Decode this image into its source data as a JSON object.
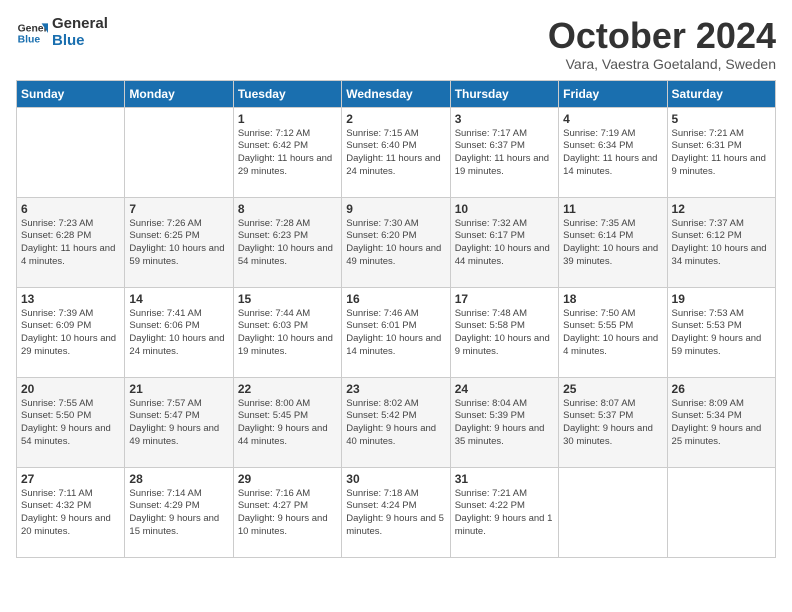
{
  "logo": {
    "line1": "General",
    "line2": "Blue"
  },
  "title": "October 2024",
  "subtitle": "Vara, Vaestra Goetaland, Sweden",
  "weekdays": [
    "Sunday",
    "Monday",
    "Tuesday",
    "Wednesday",
    "Thursday",
    "Friday",
    "Saturday"
  ],
  "weeks": [
    [
      {
        "day": "",
        "text": ""
      },
      {
        "day": "",
        "text": ""
      },
      {
        "day": "1",
        "text": "Sunrise: 7:12 AM\nSunset: 6:42 PM\nDaylight: 11 hours and 29 minutes."
      },
      {
        "day": "2",
        "text": "Sunrise: 7:15 AM\nSunset: 6:40 PM\nDaylight: 11 hours and 24 minutes."
      },
      {
        "day": "3",
        "text": "Sunrise: 7:17 AM\nSunset: 6:37 PM\nDaylight: 11 hours and 19 minutes."
      },
      {
        "day": "4",
        "text": "Sunrise: 7:19 AM\nSunset: 6:34 PM\nDaylight: 11 hours and 14 minutes."
      },
      {
        "day": "5",
        "text": "Sunrise: 7:21 AM\nSunset: 6:31 PM\nDaylight: 11 hours and 9 minutes."
      }
    ],
    [
      {
        "day": "6",
        "text": "Sunrise: 7:23 AM\nSunset: 6:28 PM\nDaylight: 11 hours and 4 minutes."
      },
      {
        "day": "7",
        "text": "Sunrise: 7:26 AM\nSunset: 6:25 PM\nDaylight: 10 hours and 59 minutes."
      },
      {
        "day": "8",
        "text": "Sunrise: 7:28 AM\nSunset: 6:23 PM\nDaylight: 10 hours and 54 minutes."
      },
      {
        "day": "9",
        "text": "Sunrise: 7:30 AM\nSunset: 6:20 PM\nDaylight: 10 hours and 49 minutes."
      },
      {
        "day": "10",
        "text": "Sunrise: 7:32 AM\nSunset: 6:17 PM\nDaylight: 10 hours and 44 minutes."
      },
      {
        "day": "11",
        "text": "Sunrise: 7:35 AM\nSunset: 6:14 PM\nDaylight: 10 hours and 39 minutes."
      },
      {
        "day": "12",
        "text": "Sunrise: 7:37 AM\nSunset: 6:12 PM\nDaylight: 10 hours and 34 minutes."
      }
    ],
    [
      {
        "day": "13",
        "text": "Sunrise: 7:39 AM\nSunset: 6:09 PM\nDaylight: 10 hours and 29 minutes."
      },
      {
        "day": "14",
        "text": "Sunrise: 7:41 AM\nSunset: 6:06 PM\nDaylight: 10 hours and 24 minutes."
      },
      {
        "day": "15",
        "text": "Sunrise: 7:44 AM\nSunset: 6:03 PM\nDaylight: 10 hours and 19 minutes."
      },
      {
        "day": "16",
        "text": "Sunrise: 7:46 AM\nSunset: 6:01 PM\nDaylight: 10 hours and 14 minutes."
      },
      {
        "day": "17",
        "text": "Sunrise: 7:48 AM\nSunset: 5:58 PM\nDaylight: 10 hours and 9 minutes."
      },
      {
        "day": "18",
        "text": "Sunrise: 7:50 AM\nSunset: 5:55 PM\nDaylight: 10 hours and 4 minutes."
      },
      {
        "day": "19",
        "text": "Sunrise: 7:53 AM\nSunset: 5:53 PM\nDaylight: 9 hours and 59 minutes."
      }
    ],
    [
      {
        "day": "20",
        "text": "Sunrise: 7:55 AM\nSunset: 5:50 PM\nDaylight: 9 hours and 54 minutes."
      },
      {
        "day": "21",
        "text": "Sunrise: 7:57 AM\nSunset: 5:47 PM\nDaylight: 9 hours and 49 minutes."
      },
      {
        "day": "22",
        "text": "Sunrise: 8:00 AM\nSunset: 5:45 PM\nDaylight: 9 hours and 44 minutes."
      },
      {
        "day": "23",
        "text": "Sunrise: 8:02 AM\nSunset: 5:42 PM\nDaylight: 9 hours and 40 minutes."
      },
      {
        "day": "24",
        "text": "Sunrise: 8:04 AM\nSunset: 5:39 PM\nDaylight: 9 hours and 35 minutes."
      },
      {
        "day": "25",
        "text": "Sunrise: 8:07 AM\nSunset: 5:37 PM\nDaylight: 9 hours and 30 minutes."
      },
      {
        "day": "26",
        "text": "Sunrise: 8:09 AM\nSunset: 5:34 PM\nDaylight: 9 hours and 25 minutes."
      }
    ],
    [
      {
        "day": "27",
        "text": "Sunrise: 7:11 AM\nSunset: 4:32 PM\nDaylight: 9 hours and 20 minutes."
      },
      {
        "day": "28",
        "text": "Sunrise: 7:14 AM\nSunset: 4:29 PM\nDaylight: 9 hours and 15 minutes."
      },
      {
        "day": "29",
        "text": "Sunrise: 7:16 AM\nSunset: 4:27 PM\nDaylight: 9 hours and 10 minutes."
      },
      {
        "day": "30",
        "text": "Sunrise: 7:18 AM\nSunset: 4:24 PM\nDaylight: 9 hours and 5 minutes."
      },
      {
        "day": "31",
        "text": "Sunrise: 7:21 AM\nSunset: 4:22 PM\nDaylight: 9 hours and 1 minute."
      },
      {
        "day": "",
        "text": ""
      },
      {
        "day": "",
        "text": ""
      }
    ]
  ]
}
